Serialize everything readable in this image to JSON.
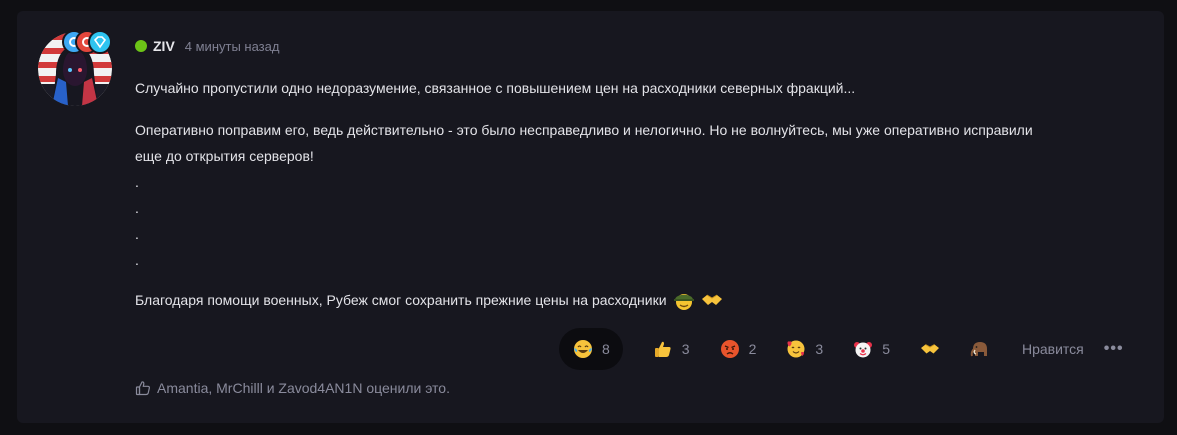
{
  "post": {
    "author": "ZIV",
    "time": "4 минуты назад",
    "online_color": "#6cc417",
    "paragraph1": "Случайно пропустили одно недоразумение, связанное с повышением цен на расходники северных фракций...",
    "paragraph2_line1": "Оперативно поправим его, ведь действительно - это было несправедливо и нелогично. Но не волнуйтесь, мы уже оперативно исправили",
    "paragraph2_line2": "еще до открытия серверов!",
    "dots": [
      ".",
      ".",
      ".",
      "."
    ],
    "paragraph3": "Благодаря помощи военных, Рубеж смог сохранить прежние цены на расходники",
    "inline_emojis": [
      "military-helmet-icon",
      "handshake-icon"
    ]
  },
  "badges": [
    {
      "icon": "badge-cyan-icon",
      "color": "#3fa9f5"
    },
    {
      "icon": "badge-red-icon",
      "color": "#e2463c"
    },
    {
      "icon": "diamond-badge-icon",
      "color": "#2ec4f0"
    }
  ],
  "reactions": [
    {
      "icon": "tears-of-joy-icon",
      "count": "8",
      "active": true
    },
    {
      "icon": "thumbs-up-icon",
      "count": "3"
    },
    {
      "icon": "angry-face-icon",
      "count": "2"
    },
    {
      "icon": "smiling-hearts-icon",
      "count": "3"
    },
    {
      "icon": "clown-face-icon",
      "count": "5"
    },
    {
      "icon": "handshake-icon",
      "count": ""
    },
    {
      "icon": "mammoth-icon",
      "count": ""
    }
  ],
  "actions": {
    "like_label": "Нравится",
    "more_label": "•••"
  },
  "liked_by": "Amantia, MrChilll и Zavod4AN1N оценили это."
}
